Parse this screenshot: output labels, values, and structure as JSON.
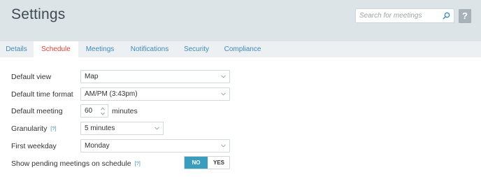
{
  "header": {
    "title": "Settings",
    "search_placeholder": "Search for meetings",
    "help_label": "?"
  },
  "tabs": [
    {
      "label": "Details",
      "active": false
    },
    {
      "label": "Schedule",
      "active": true
    },
    {
      "label": "Meetings",
      "active": false
    },
    {
      "label": "Notifications",
      "active": false
    },
    {
      "label": "Security",
      "active": false
    },
    {
      "label": "Compliance",
      "active": false
    }
  ],
  "settings": {
    "default_view": {
      "label": "Default view",
      "value": "Map"
    },
    "time_format": {
      "label": "Default time format",
      "value": "AM/PM (3:43pm)"
    },
    "default_meeting": {
      "label": "Default meeting",
      "value": "60",
      "unit": "minutes"
    },
    "granularity": {
      "label": "Granularity",
      "help": "[?]",
      "value": "5 minutes"
    },
    "first_weekday": {
      "label": "First weekday",
      "value": "Monday"
    },
    "pending": {
      "label": "Show pending meetings on schedule",
      "help": "[?]",
      "no_label": "NO",
      "yes_label": "YES",
      "selected": "NO"
    }
  },
  "colors": {
    "accent": "#3a9cbf",
    "active_tab": "#d9433a",
    "link": "#3d89b8",
    "header_bg": "#dde4e8"
  },
  "icons": {
    "search": "search-icon",
    "chevron": "chevron-down-icon",
    "stepper": "stepper-arrows-icon"
  }
}
